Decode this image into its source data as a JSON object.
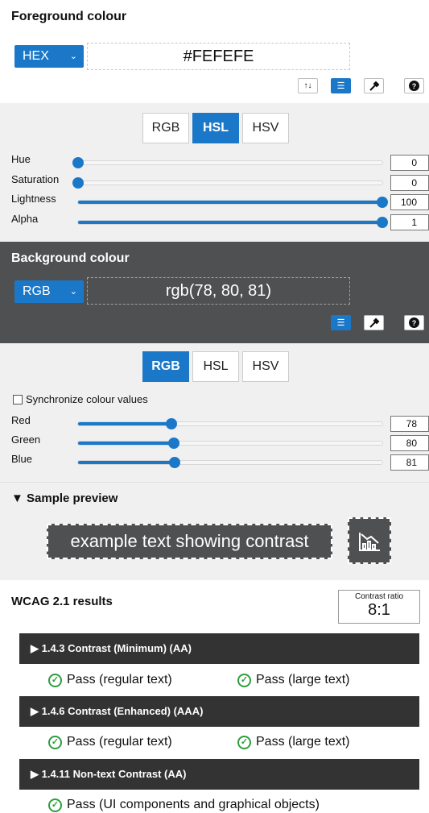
{
  "foreground": {
    "title": "Foreground colour",
    "format": "HEX",
    "value": "#FEFEFE",
    "tools": [
      "swap-icon",
      "sliders-icon",
      "eyedropper-icon",
      "help-icon"
    ],
    "help": "?",
    "swap_glyph": "↑↓",
    "sliders_glyph": "☰"
  },
  "fg_sliders": {
    "tabs": [
      "RGB",
      "HSL",
      "HSV"
    ],
    "selected_tab": "HSL",
    "rows": [
      {
        "label": "Hue",
        "value": "0",
        "level": 0
      },
      {
        "label": "Saturation",
        "value": "0",
        "level": 0
      },
      {
        "label": "Lightness",
        "value": "100",
        "level": 1
      },
      {
        "label": "Alpha",
        "value": "1",
        "level": 1
      }
    ]
  },
  "background": {
    "title": "Background colour",
    "format": "RGB",
    "value": "rgb(78, 80, 81)",
    "help": "?",
    "sliders_glyph": "☰"
  },
  "bg_sliders": {
    "tabs": [
      "RGB",
      "HSL",
      "HSV"
    ],
    "selected_tab": "RGB",
    "sync_label": "Synchronize colour values",
    "rows": [
      {
        "label": "Red",
        "value": "78",
        "level": 0.306
      },
      {
        "label": "Green",
        "value": "80",
        "level": 0.314
      },
      {
        "label": "Blue",
        "value": "81",
        "level": 0.318
      }
    ]
  },
  "preview": {
    "title": "▼ Sample preview",
    "sample_text": "example text showing contrast"
  },
  "results": {
    "title": "WCAG 2.1 results",
    "ratio_label": "Contrast ratio",
    "ratio_value": "8:1",
    "criteria": [
      {
        "label": "▶ 1.4.3 Contrast (Minimum) (AA)",
        "results": [
          "Pass (regular text)",
          "Pass (large text)"
        ]
      },
      {
        "label": "▶ 1.4.6 Contrast (Enhanced) (AAA)",
        "results": [
          "Pass (regular text)",
          "Pass (large text)"
        ]
      },
      {
        "label": "▶ 1.4.11 Non-text Contrast (AA)",
        "results": [
          "Pass (UI components and graphical objects)"
        ]
      }
    ]
  },
  "colors": {
    "accent": "#1b78c9",
    "foreground": "#FEFEFE",
    "background": "#4e5051",
    "pass": "#2e9e3e"
  }
}
